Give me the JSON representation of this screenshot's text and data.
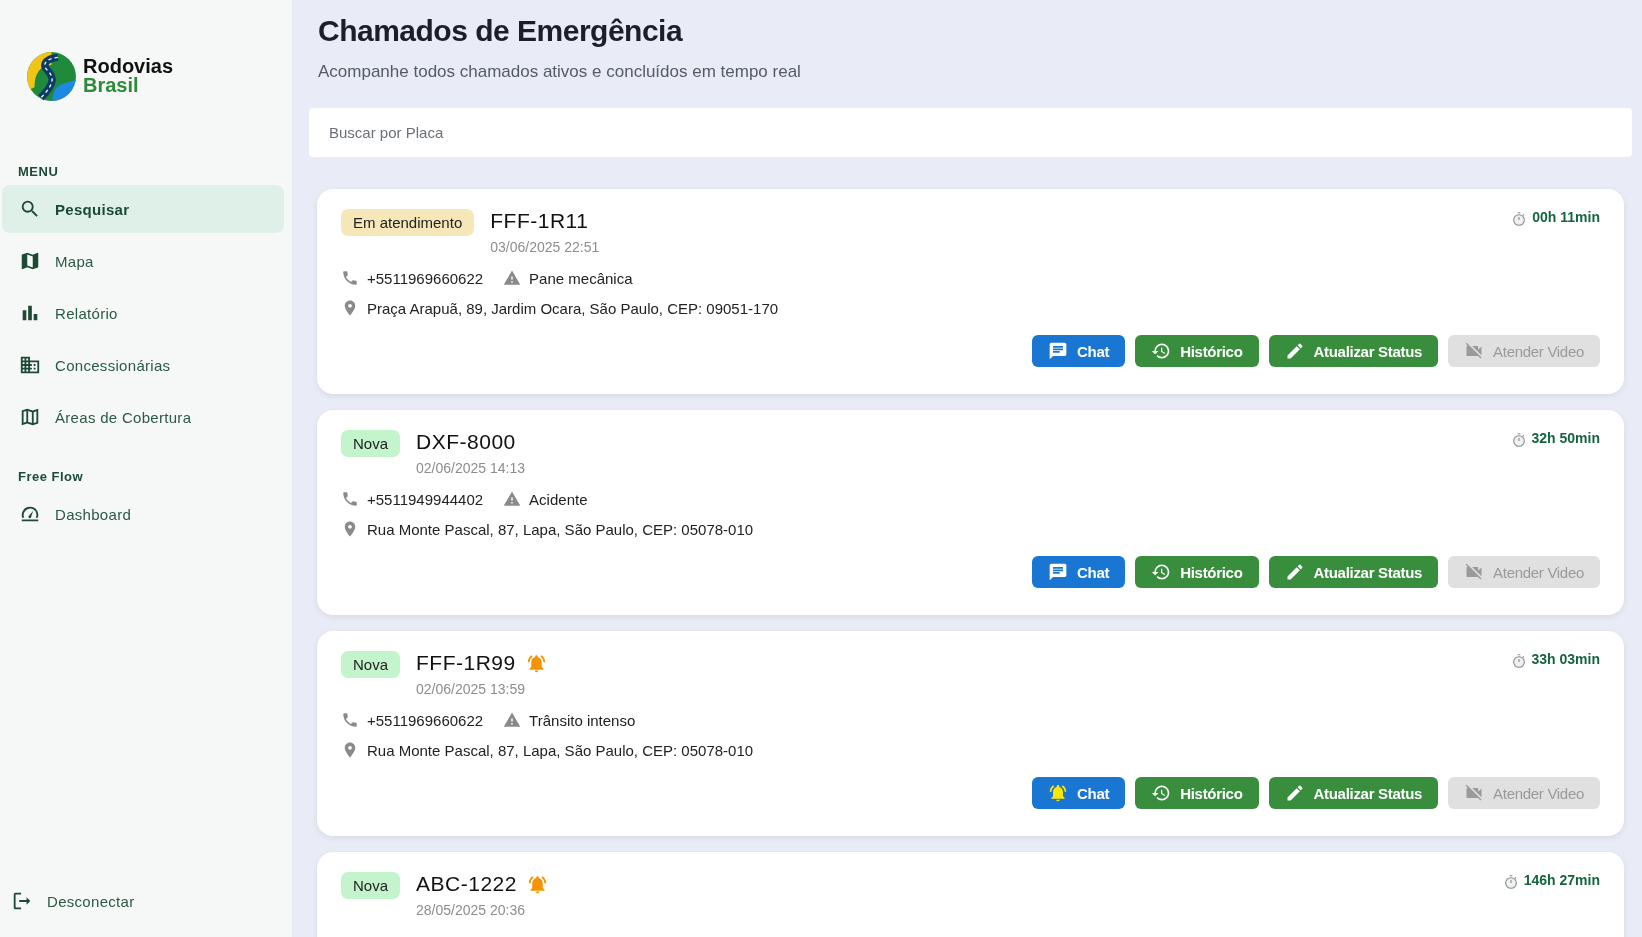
{
  "brand": {
    "line_1": "Rodovias",
    "line_2": "Brasil"
  },
  "sidebar": {
    "sections": [
      {
        "title": "MENU",
        "items": [
          {
            "label": "Pesquisar",
            "kind": "search",
            "selected": true
          },
          {
            "label": "Mapa",
            "kind": "map",
            "selected": false
          },
          {
            "label": "Relatório",
            "kind": "chart",
            "selected": false
          },
          {
            "label": "Concessionárias",
            "kind": "building",
            "selected": false
          },
          {
            "label": "Áreas de Cobertura",
            "kind": "coverage",
            "selected": false
          }
        ]
      },
      {
        "title": "Free Flow",
        "items": [
          {
            "label": "Dashboard",
            "kind": "gauge",
            "selected": false
          }
        ]
      }
    ],
    "logout": "Desconectar"
  },
  "header": {
    "title": "Chamados de Emergência",
    "subtitle": "Acompanhe todos chamados ativos e concluídos em tempo real"
  },
  "search": {
    "placeholder": "Buscar por Placa"
  },
  "calls": [
    {
      "status": "Em atendimento",
      "kind": "in_progress",
      "plate": "FFF-1R11",
      "alert": false,
      "datetime": "03/06/2025 22:51",
      "elapsed": "00h 11min",
      "phone": "+5511969660622",
      "incident": "Pane mecânica",
      "address": "Praça Arapuã, 89, Jardim Ocara, São Paulo, CEP: 09051-170",
      "buttons": [
        {
          "kind": "chat",
          "label": "Chat",
          "disabled": false
        },
        {
          "kind": "history",
          "label": "Histórico",
          "disabled": false
        },
        {
          "kind": "update",
          "label": "Atualizar Status",
          "disabled": false
        },
        {
          "kind": "video",
          "label": "Atender Video",
          "disabled": true
        }
      ]
    },
    {
      "status": "Nova",
      "kind": "new",
      "plate": "DXF-8000",
      "alert": false,
      "datetime": "02/06/2025 14:13",
      "elapsed": "32h 50min",
      "phone": "+5511949944402",
      "incident": "Acidente",
      "address": "Rua Monte Pascal, 87, Lapa, São Paulo, CEP: 05078-010",
      "buttons": [
        {
          "kind": "chat",
          "label": "Chat",
          "disabled": false
        },
        {
          "kind": "history",
          "label": "Histórico",
          "disabled": false
        },
        {
          "kind": "update",
          "label": "Atualizar Status",
          "disabled": false
        },
        {
          "kind": "video",
          "label": "Atender Video",
          "disabled": true
        }
      ]
    },
    {
      "status": "Nova",
      "kind": "new",
      "plate": "FFF-1R99",
      "alert": true,
      "datetime": "02/06/2025 13:59",
      "elapsed": "33h 03min",
      "phone": "+5511969660622",
      "incident": "Trânsito intenso",
      "address": "Rua Monte Pascal, 87, Lapa, São Paulo, CEP: 05078-010",
      "buttons": [
        {
          "kind": "chat",
          "label": "Chat",
          "disabled": false
        },
        {
          "kind": "history",
          "label": "Histórico",
          "disabled": false
        },
        {
          "kind": "update",
          "label": "Atualizar Status",
          "disabled": false
        },
        {
          "kind": "video",
          "label": "Atender Video",
          "disabled": true
        }
      ]
    },
    {
      "status": "Nova",
      "kind": "new",
      "plate": "ABC-1222",
      "alert": true,
      "datetime": "28/05/2025 20:36",
      "elapsed": "146h 27min"
    }
  ]
}
